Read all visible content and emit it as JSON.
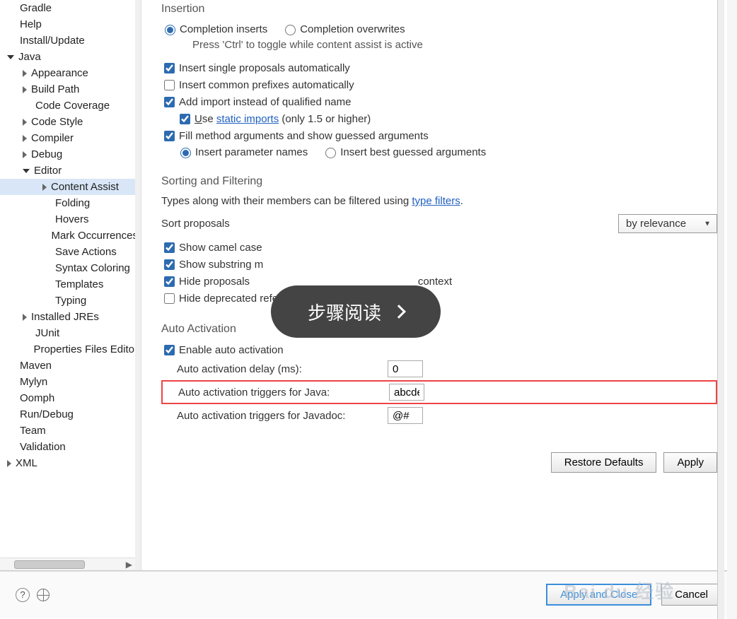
{
  "sidebar": {
    "items": [
      {
        "label": "Gradle",
        "level": 0,
        "arrow": "none"
      },
      {
        "label": "Help",
        "level": 0,
        "arrow": "none"
      },
      {
        "label": "Install/Update",
        "level": 0,
        "arrow": "none"
      },
      {
        "label": "Java",
        "level": 0,
        "arrow": "down"
      },
      {
        "label": "Appearance",
        "level": 1,
        "arrow": "right"
      },
      {
        "label": "Build Path",
        "level": 1,
        "arrow": "right"
      },
      {
        "label": "Code Coverage",
        "level": 1,
        "arrow": "none"
      },
      {
        "label": "Code Style",
        "level": 1,
        "arrow": "right"
      },
      {
        "label": "Compiler",
        "level": 1,
        "arrow": "right"
      },
      {
        "label": "Debug",
        "level": 1,
        "arrow": "right"
      },
      {
        "label": "Editor",
        "level": 1,
        "arrow": "down"
      },
      {
        "label": "Content Assist",
        "level": 2,
        "arrow": "right",
        "selected": true
      },
      {
        "label": "Folding",
        "level": 2,
        "arrow": "none"
      },
      {
        "label": "Hovers",
        "level": 2,
        "arrow": "none"
      },
      {
        "label": "Mark Occurrences",
        "level": 2,
        "arrow": "none"
      },
      {
        "label": "Save Actions",
        "level": 2,
        "arrow": "none"
      },
      {
        "label": "Syntax Coloring",
        "level": 2,
        "arrow": "none"
      },
      {
        "label": "Templates",
        "level": 2,
        "arrow": "none"
      },
      {
        "label": "Typing",
        "level": 2,
        "arrow": "none"
      },
      {
        "label": "Installed JREs",
        "level": 1,
        "arrow": "right"
      },
      {
        "label": "JUnit",
        "level": 1,
        "arrow": "none"
      },
      {
        "label": "Properties Files Editor",
        "level": 1,
        "arrow": "none"
      },
      {
        "label": "Maven",
        "level": 0,
        "arrow": "none"
      },
      {
        "label": "Mylyn",
        "level": 0,
        "arrow": "none"
      },
      {
        "label": "Oomph",
        "level": 0,
        "arrow": "none"
      },
      {
        "label": "Run/Debug",
        "level": 0,
        "arrow": "none"
      },
      {
        "label": "Team",
        "level": 0,
        "arrow": "none"
      },
      {
        "label": "Validation",
        "level": 0,
        "arrow": "none"
      },
      {
        "label": "XML",
        "level": 0,
        "arrow": "right"
      }
    ]
  },
  "sections": {
    "insertion": "Insertion",
    "sorting": "Sorting and Filtering",
    "auto": "Auto Activation"
  },
  "radios": {
    "completion_inserts": "Completion inserts",
    "completion_overwrites": "Completion overwrites",
    "insert_param_names": "Insert parameter names",
    "insert_best_guessed": "Insert best guessed arguments"
  },
  "hint_ctrl": "Press 'Ctrl' to toggle while content assist is active",
  "checks": {
    "insert_single": "Insert single proposals automatically",
    "insert_common": "Insert common prefixes automatically",
    "add_import": "Add import instead of qualified name",
    "use_static_pre": "se ",
    "use_static_link": "static imports",
    "use_static_post": " (only 1.5 or higher)",
    "fill_method": "Fill method arguments and show guessed arguments",
    "show_camel": "Show camel case",
    "show_substring": "Show substring m",
    "hide_proposals": "Hide proposals",
    "hide_proposals_post": " context",
    "hide_deprecated": "Hide deprecated references",
    "enable_auto": "Enable auto activation"
  },
  "filter_text_pre": "Types along with their members can be filtered using ",
  "filter_link": "type filters",
  "filter_text_post": ".",
  "sort_label": "Sort proposals",
  "sort_value": "by relevance",
  "auto": {
    "delay_label": "Auto activation delay (ms):",
    "delay_value": "0",
    "java_label": "Auto activation triggers for Java:",
    "java_value": "abcde",
    "javadoc_label": "Auto activation triggers for Javadoc:",
    "javadoc_value": "@#"
  },
  "buttons": {
    "restore": "Restore Defaults",
    "apply": "Apply",
    "apply_close": "Apply and Close",
    "cancel": "Cancel"
  },
  "overlay": "步骤阅读",
  "watermark": "Bai du 经验"
}
